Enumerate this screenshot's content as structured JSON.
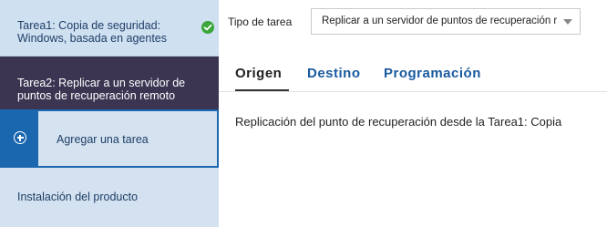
{
  "sidebar": {
    "task1_label": "Tarea1: Copia de seguridad: Windows, basada en agentes",
    "task1_status_icon": "check-circle-icon",
    "task2_label": "Tarea2: Replicar a un servidor de puntos de recuperación remoto",
    "add_task_label": "Agregar una tarea",
    "add_task_icon": "plus-circle-icon",
    "install_label": "Instalación del producto"
  },
  "main": {
    "task_type_label": "Tipo de tarea",
    "task_type_value": "Replicar a un servidor de puntos de recuperación r",
    "tabs": [
      {
        "label": "Origen",
        "active": true
      },
      {
        "label": "Destino",
        "active": false
      },
      {
        "label": "Programación",
        "active": false
      }
    ],
    "content_text": "Replicación del punto de recuperación desde la Tarea1: Copia"
  },
  "colors": {
    "sidebar_bg": "#d3e1f0",
    "selected_task_bg": "#3b3552",
    "accent_blue": "#1a67b0",
    "success_green": "#3aa63a",
    "tab_link": "#1a5aa0"
  }
}
